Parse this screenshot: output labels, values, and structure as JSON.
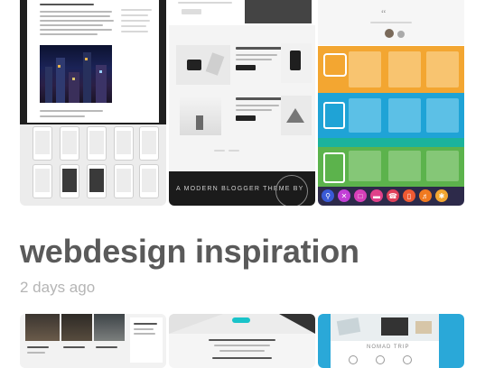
{
  "board": {
    "title": "webdesign inspiration",
    "updated": "2 days ago"
  },
  "tiles": {
    "blog_banner": "A MODERN BLOGGER THEME BY",
    "blog_heading_1": "CREATIVE MODERN DESKTOP IDEAS",
    "blog_heading_2": "MINIMALIST DESK DESIGN INSPIRATION",
    "bottom_mid_heading": "",
    "bottom_right_heading": "NOMAD TRIP"
  },
  "colors": {
    "title": "#5a5a5a",
    "meta": "#b5b5b5",
    "pricing_orange": "#f3a631",
    "pricing_blue": "#1fa3d6",
    "pricing_green": "#5cb34c",
    "bottom_blue": "#2aa8d8"
  },
  "icons": [
    "search-icon",
    "close-icon",
    "chat-icon",
    "folder-icon",
    "phone-icon",
    "mobile-icon",
    "headphones-icon",
    "puzzle-icon"
  ]
}
